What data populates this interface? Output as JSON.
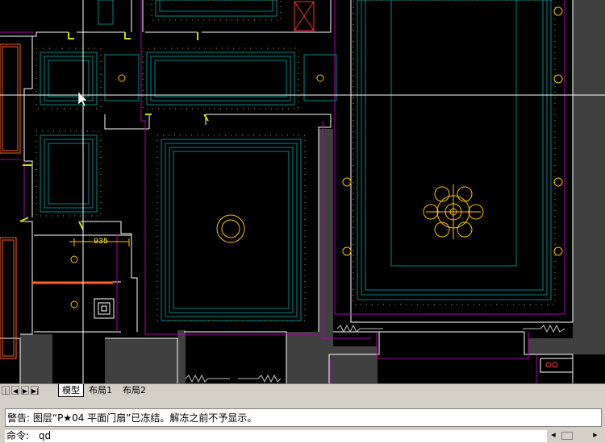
{
  "layout_tabs": [
    {
      "label": "模型",
      "active": true
    },
    {
      "label": "布局1",
      "active": false
    },
    {
      "label": "布局2",
      "active": false
    }
  ],
  "nav_buttons": [
    "first",
    "prev",
    "next",
    "last"
  ],
  "command_history": "警告: 图层“P★04 平面门扇”已冻结。解冻之前不予显示。",
  "command_prompt": "命令:",
  "command_input": "qd",
  "drawing": {
    "dimension_label": "935",
    "background": "#000000",
    "colors": {
      "wall": "#ffffff",
      "magenta": "#c000c0",
      "cyan": "#00a0a0",
      "yellow": "#ffc000",
      "orange": "#ff8000",
      "red": "#ff2020"
    }
  }
}
